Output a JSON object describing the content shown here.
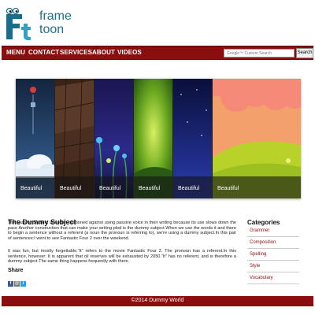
{
  "logo": {
    "line1": "frame",
    "line2": "toon",
    "colors": {
      "mark": "#1a6d8a",
      "accent": "#34a0c4",
      "text": "#1f6f8b"
    }
  },
  "nav": {
    "items": [
      {
        "label": "MENU"
      },
      {
        "label": "CONTACT"
      },
      {
        "label": "SERVICES"
      },
      {
        "label": "ABOUT"
      },
      {
        "label": "VIDEOS"
      }
    ],
    "search": {
      "placeholder": "Google™ Custom Search",
      "button": "Search"
    },
    "color": "#8b0e0e"
  },
  "slider": {
    "slides": [
      {
        "caption": "Beautiful",
        "icon": "cloud-balloon-image"
      },
      {
        "caption": "Beautiful",
        "icon": "wood-bridge-image"
      },
      {
        "caption": "Beautiful",
        "icon": "night-flowers-image"
      },
      {
        "caption": "Beautiful",
        "icon": "green-glow-image"
      },
      {
        "caption": "Beautiful",
        "icon": "starry-night-image"
      },
      {
        "caption": "Beautiful",
        "icon": "sunset-hills-image"
      }
    ]
  },
  "content": {
    "title": "The Dummy Subject",
    "paragraph1": "The Dummy Subject are often cautioned against using passive voice in their writing because its use slows down the pace Another construction that can make your writing plod is the dummy subject.When we use the words it and there to begin a sentence without a referent (a noun the pronoun is referring to), we're using a dummy subject.In this pair of sentences:I went to see Fantastic Four 2 over the weekend.",
    "paragraph2": "It was fun, but mostly forgettable.“It” refers to the movie Fantastic Four 2. The pronoun has a referent.In this sentence, however: It is apparent that oil reserves will be exhausted by 2050.“It” has no referent, and is therefore a dummy subject.The same thing happens frequently with there.",
    "share_label": "Share"
  },
  "sidebar": {
    "title": "Categories",
    "items": [
      "Grammer",
      "Composition",
      "Spelling",
      "Style",
      "Vocabulary"
    ]
  },
  "footer": {
    "text": "©2014 Dummy World",
    "color": "#8b0e0e"
  }
}
